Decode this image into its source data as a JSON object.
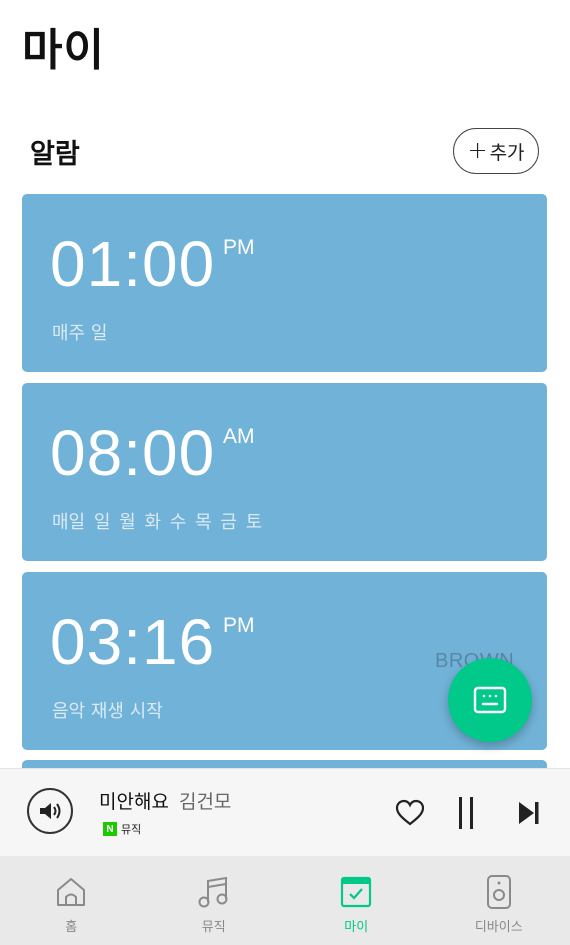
{
  "page": {
    "title": "마이"
  },
  "alarm_section": {
    "title": "알람",
    "add_button": {
      "icon": "plus-icon",
      "label": "추가"
    }
  },
  "alarms": [
    {
      "time": "01:00",
      "ampm": "PM",
      "sub_prefix": "매주",
      "days": [
        "일"
      ],
      "brand": ""
    },
    {
      "time": "08:00",
      "ampm": "AM",
      "sub_prefix": "매일",
      "days": [
        "일",
        "월",
        "화",
        "수",
        "목",
        "금",
        "토"
      ],
      "brand": ""
    },
    {
      "time": "03:16",
      "ampm": "PM",
      "sub_prefix": "음악 재생 시작",
      "days": [],
      "brand": "BROWN"
    }
  ],
  "fab": {
    "icon": "keyboard-icon"
  },
  "player": {
    "song_title": "미안해요",
    "artist": "김건모",
    "source_badge": "N",
    "source_label": "뮤직",
    "icons": {
      "speaker": "speaker-icon",
      "like": "heart-icon",
      "pause": "pause-icon",
      "next": "skip-next-icon"
    }
  },
  "bottom_nav": [
    {
      "key": "home",
      "label": "홈",
      "icon": "home-icon",
      "active": false
    },
    {
      "key": "music",
      "label": "뮤직",
      "icon": "music-note-icon",
      "active": false
    },
    {
      "key": "my",
      "label": "마이",
      "icon": "calendar-check-icon",
      "active": true
    },
    {
      "key": "device",
      "label": "디바이스",
      "icon": "speaker-device-icon",
      "active": false
    }
  ],
  "colors": {
    "card": "#71b3d8",
    "accent": "#00c98a",
    "nav_bg": "#e9e9e9",
    "player_bg": "#f6f6f6"
  }
}
